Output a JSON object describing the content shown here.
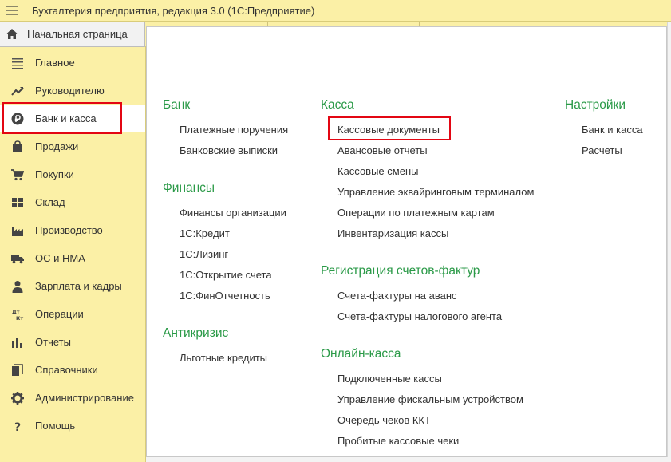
{
  "window": {
    "title": "Бухгалтерия предприятия, редакция 3.0  (1С:Предприятие)"
  },
  "tabs": {
    "home_label": "Начальная страница"
  },
  "sidebar": {
    "items": [
      {
        "label": "Главное",
        "icon": "menu-lines-icon"
      },
      {
        "label": "Руководителю",
        "icon": "trend-chart-icon"
      },
      {
        "label": "Банк и касса",
        "icon": "ruble-coin-icon",
        "active": true
      },
      {
        "label": "Продажи",
        "icon": "shopping-bag-icon"
      },
      {
        "label": "Покупки",
        "icon": "shopping-cart-icon"
      },
      {
        "label": "Склад",
        "icon": "warehouse-grid-icon"
      },
      {
        "label": "Производство",
        "icon": "factory-icon"
      },
      {
        "label": "ОС и НМА",
        "icon": "truck-icon"
      },
      {
        "label": "Зарплата и кадры",
        "icon": "person-icon"
      },
      {
        "label": "Операции",
        "icon": "debit-credit-icon"
      },
      {
        "label": "Отчеты",
        "icon": "bar-chart-icon"
      },
      {
        "label": "Справочники",
        "icon": "books-icon"
      },
      {
        "label": "Администрирование",
        "icon": "gear-icon"
      },
      {
        "label": "Помощь",
        "icon": "question-icon"
      }
    ]
  },
  "sections": {
    "bank": {
      "title": "Банк",
      "links": [
        "Платежные поручения",
        "Банковские выписки"
      ]
    },
    "finance": {
      "title": "Финансы",
      "links": [
        "Финансы организации",
        "1С:Кредит",
        "1С:Лизинг",
        "1С:Открытие счета",
        "1С:ФинОтчетность"
      ]
    },
    "anticrisis": {
      "title": "Антикризис",
      "links": [
        "Льготные кредиты"
      ]
    },
    "cash": {
      "title": "Касса",
      "links": [
        "Кассовые документы",
        "Авансовые отчеты",
        "Кассовые смены",
        "Управление эквайринговым терминалом",
        "Операции по платежным картам",
        "Инвентаризация кассы"
      ]
    },
    "invoices": {
      "title": "Регистрация счетов-фактур",
      "links": [
        "Счета-фактуры на аванс",
        "Счета-фактуры налогового агента"
      ]
    },
    "online_cash": {
      "title": "Онлайн-касса",
      "links": [
        "Подключенные кассы",
        "Управление фискальным устройством",
        "Очередь чеков ККТ",
        "Пробитые кассовые чеки"
      ]
    },
    "settings": {
      "title": "Настройки",
      "links": [
        "Банк и касса",
        "Расчеты"
      ]
    }
  },
  "colors": {
    "panel": "#fbf0a6",
    "section_title": "#2b9a48",
    "highlight": "#e30613"
  }
}
